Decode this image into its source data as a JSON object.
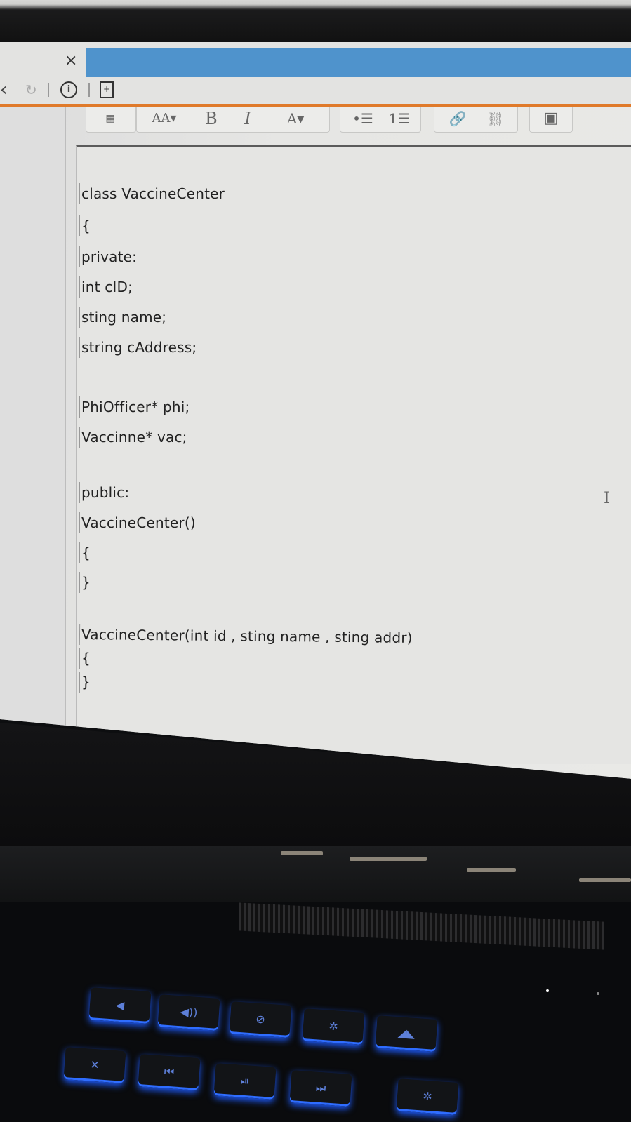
{
  "browser": {
    "tab_close": "×",
    "nav": {
      "back": "‹",
      "reload": "↻",
      "info": "i",
      "page": "+"
    }
  },
  "toolbar": {
    "font_size": "AA▾",
    "bold": "B",
    "italic": "I",
    "font_color": "A▾",
    "bullet_list": "•☰",
    "numbered_list": "1☰",
    "link": "🔗",
    "unlink": "⛓",
    "image": "▣"
  },
  "editor": {
    "lines": [
      "class VaccineCenter",
      "{",
      "private:",
      "int cID;",
      "sting name;",
      "string cAddress;",
      "",
      "PhiOfficer* phi;",
      "Vaccinne* vac;",
      "",
      "public:",
      "VaccineCenter()",
      "{",
      "}",
      "",
      "VaccineCenter(int id , sting name , sting addr)",
      "{",
      "}"
    ],
    "cursor": "I"
  },
  "colors": {
    "tab_accent": "#4f93cc",
    "orange_rule": "#e07a2a",
    "key_backlight": "#2f6dff"
  }
}
